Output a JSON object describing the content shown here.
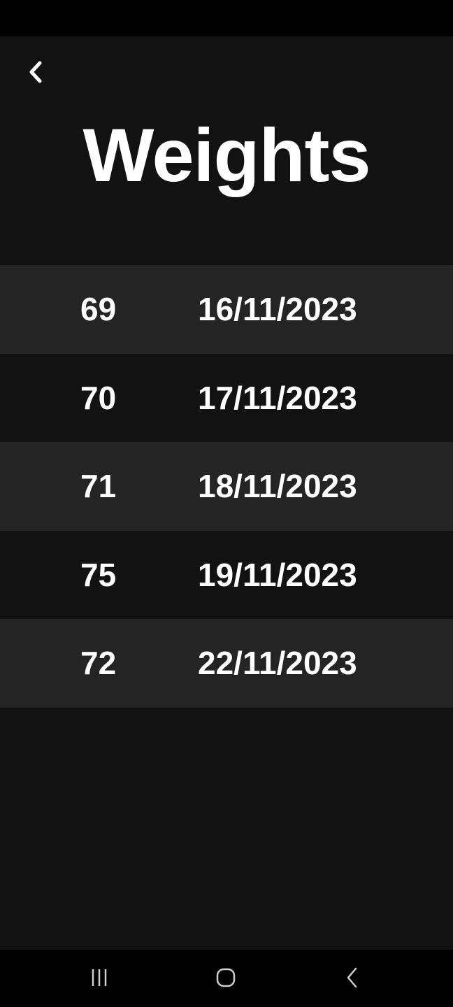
{
  "header": {
    "title": "Weights",
    "back_icon": "chevron-left-icon"
  },
  "weights": [
    {
      "value": "69",
      "date": "16/11/2023"
    },
    {
      "value": "70",
      "date": "17/11/2023"
    },
    {
      "value": "71",
      "date": "18/11/2023"
    },
    {
      "value": "75",
      "date": "19/11/2023"
    },
    {
      "value": "72",
      "date": "22/11/2023"
    }
  ],
  "navigation_bar": {
    "recents_icon": "recent-apps-icon",
    "home_icon": "home-icon",
    "back_icon": "back-icon"
  },
  "colors": {
    "background": "#121212",
    "row_alt": "#242424",
    "text": "#ffffff",
    "system_bar": "#000000"
  }
}
